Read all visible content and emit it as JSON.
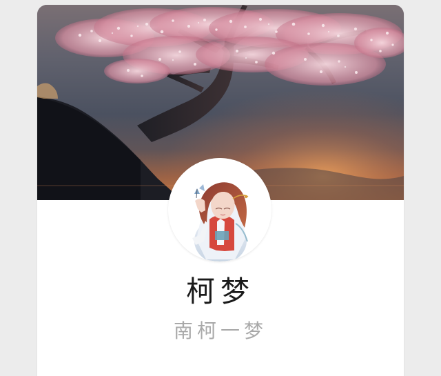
{
  "profile": {
    "name": "柯梦",
    "signature": "南柯一梦"
  },
  "visuals": {
    "page_background": "#ececec",
    "card_background": "#ffffff",
    "name_color": "#1a1a1a",
    "signature_color": "#a9a9a9",
    "cover_theme": "cherry-blossom-tree-sunset",
    "avatar_theme": "hanfu-girl-with-butterfly"
  }
}
